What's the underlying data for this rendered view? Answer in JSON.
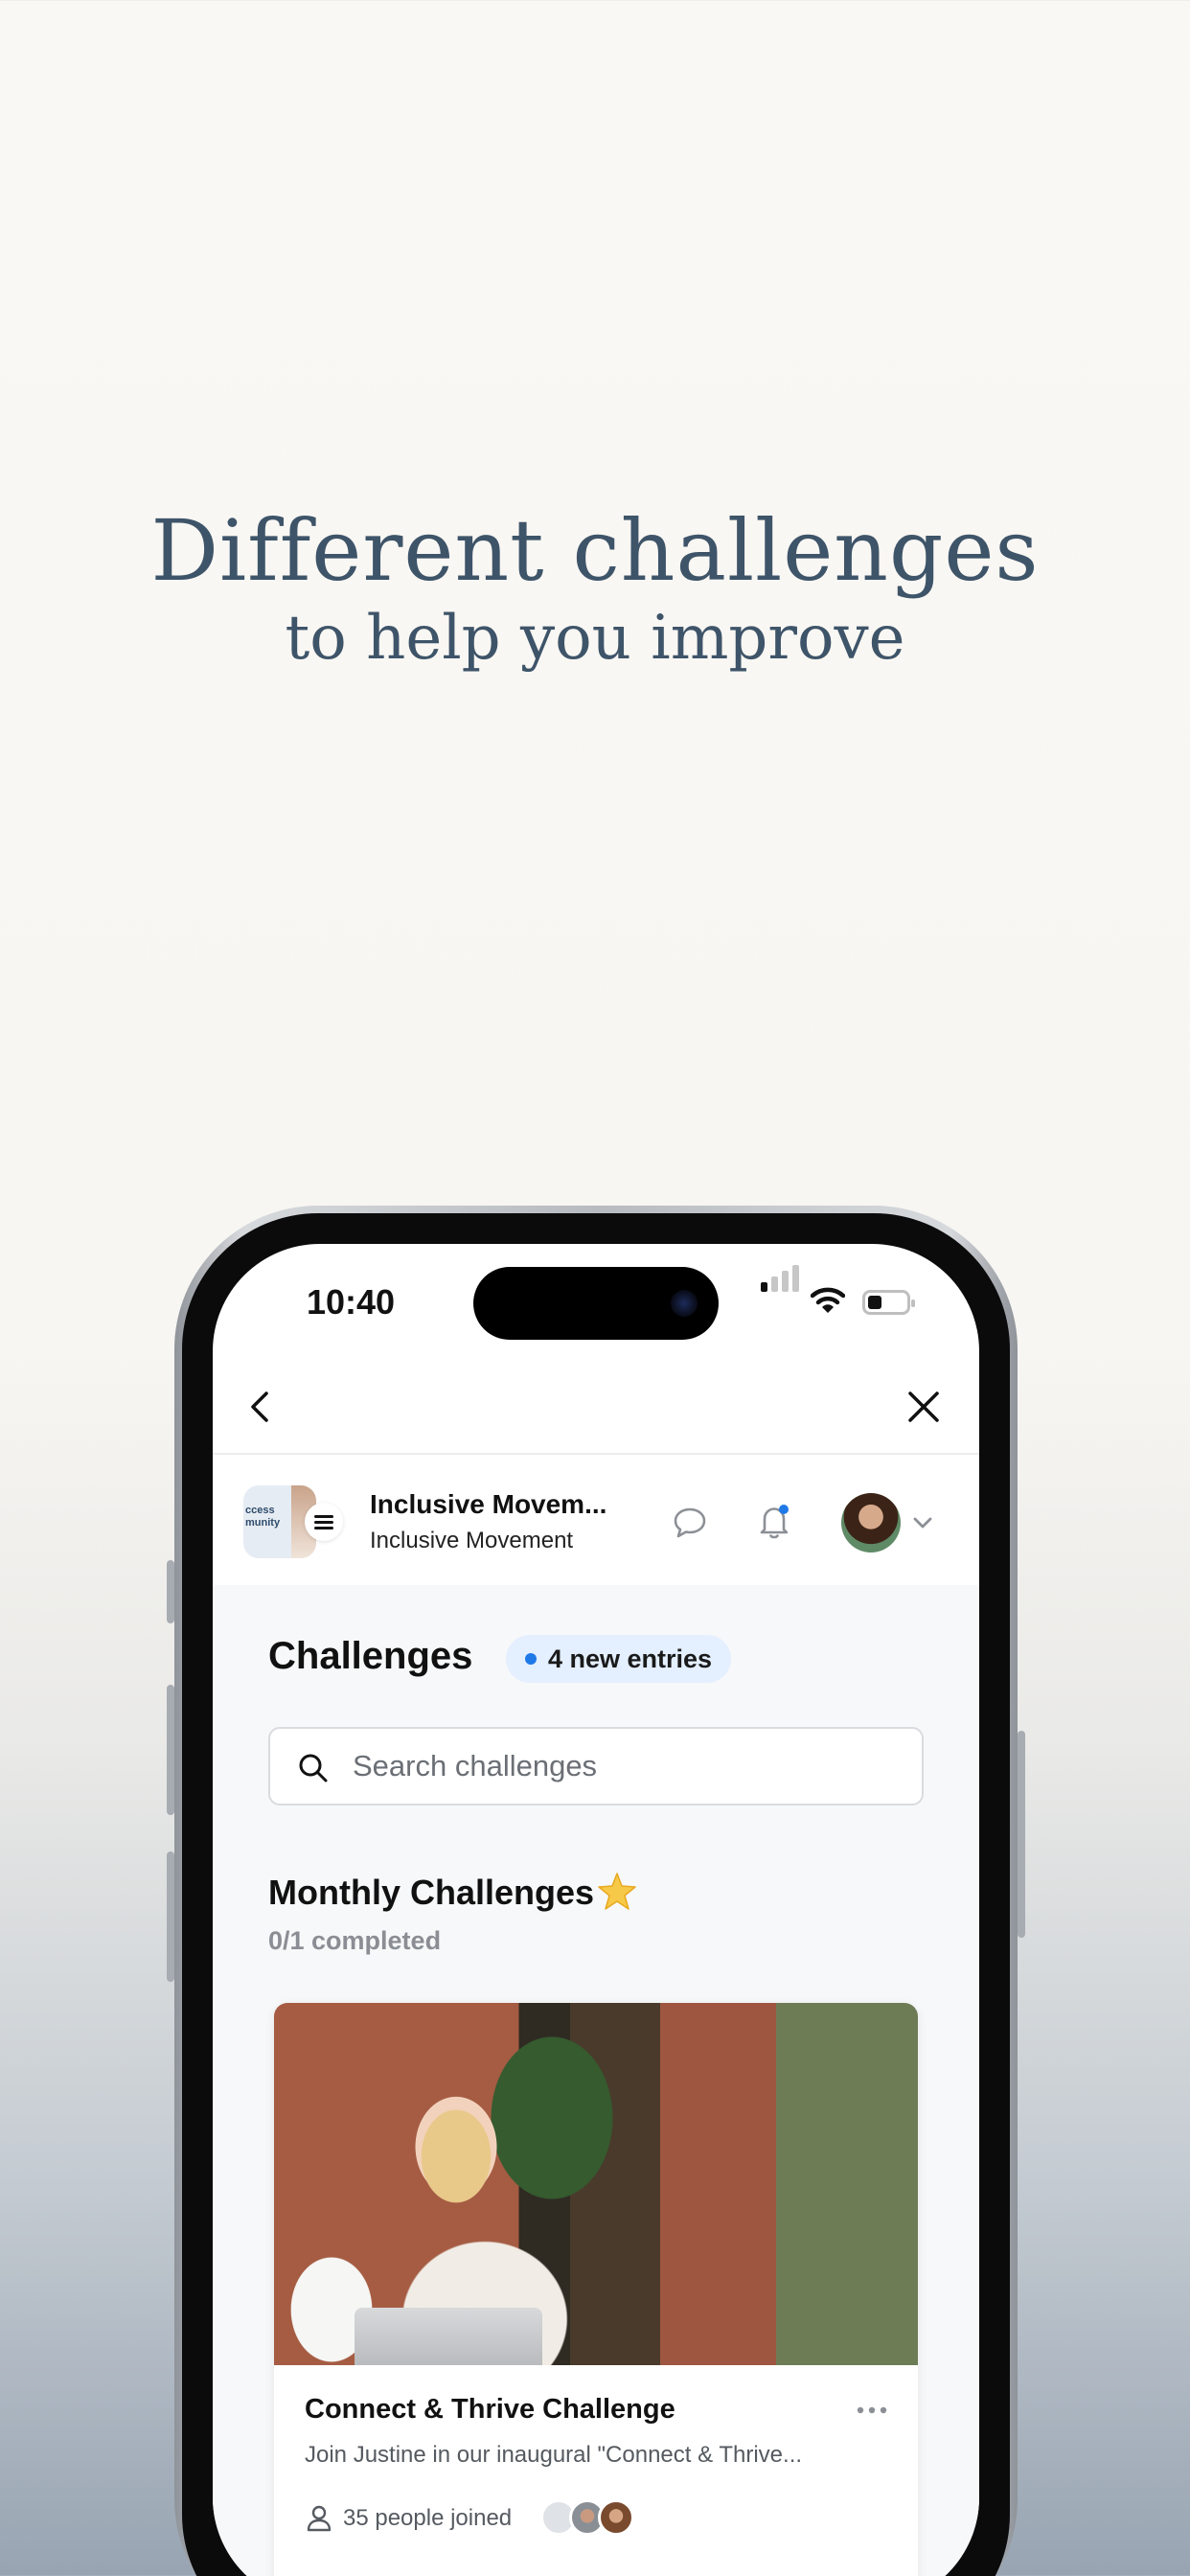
{
  "hero": {
    "title": "Different challenges",
    "subtitle": "to help you improve"
  },
  "status_bar": {
    "time": "10:40"
  },
  "community": {
    "logo_text": "ccess\nmunity",
    "name": "Inclusive Movem...",
    "subtitle": "Inclusive Movement"
  },
  "challenges": {
    "title": "Challenges",
    "new_entries": "4 new entries",
    "search_placeholder": "Search challenges"
  },
  "monthly": {
    "title": "Monthly Challenges",
    "completed": "0/1 completed"
  },
  "card": {
    "title": "Connect & Thrive Challenge",
    "description": "Join Justine in our inaugural \"Connect & Thrive...",
    "joined": "35 people joined"
  },
  "colors": {
    "hero_text": "#3e5469",
    "accent_blue": "#1f7ae8",
    "pill_bg": "#e4efff"
  },
  "icons": [
    "back-icon",
    "close-icon",
    "menu-icon",
    "chat-icon",
    "bell-icon",
    "chevron-down-icon",
    "search-icon",
    "star-icon",
    "more-icon",
    "person-icon",
    "wifi-icon",
    "battery-icon",
    "signal-icon"
  ]
}
